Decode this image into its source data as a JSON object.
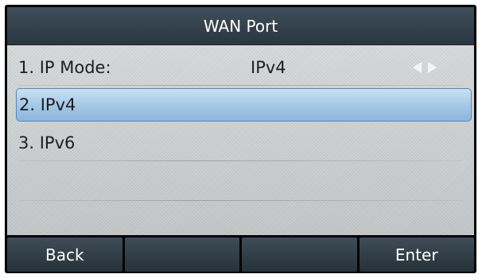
{
  "header": {
    "title": "WAN Port"
  },
  "items": [
    {
      "label": "1. IP Mode:",
      "value": "IPv4"
    },
    {
      "label": "2. IPv4"
    },
    {
      "label": "3. IPv6"
    }
  ],
  "selected_index": 1,
  "icons": {
    "left": "arrow-left-icon",
    "right": "arrow-right-icon"
  },
  "softkeys": [
    "Back",
    "",
    "",
    "Enter"
  ],
  "colors": {
    "title_bar": "#2f3c46",
    "selection": "#a2c6e6",
    "softkey": "#2f3c46"
  }
}
